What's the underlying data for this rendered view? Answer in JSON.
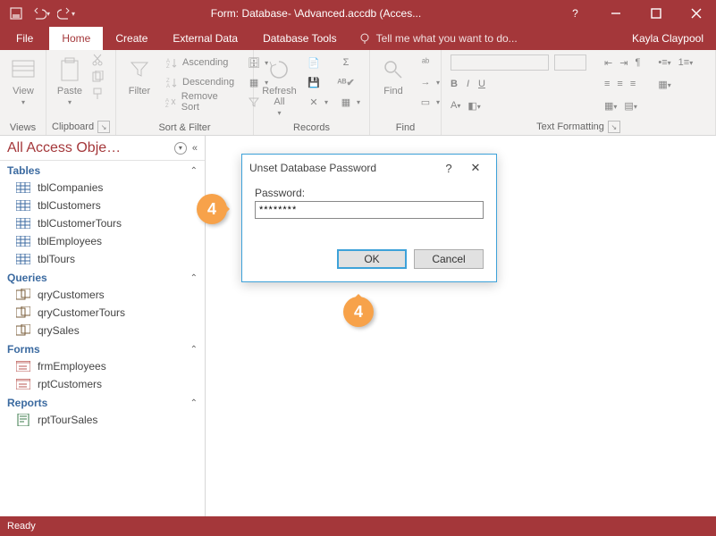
{
  "title": "Form: Database- \\Advanced.accdb (Acces...",
  "user": "Kayla Claypool",
  "tabs": {
    "file": "File",
    "home": "Home",
    "create": "Create",
    "external": "External Data",
    "tools": "Database Tools",
    "tellme": "Tell me what you want to do..."
  },
  "ribbon": {
    "views": {
      "label": "Views",
      "view": "View"
    },
    "clipboard": {
      "label": "Clipboard",
      "paste": "Paste"
    },
    "sortfilter": {
      "label": "Sort & Filter",
      "filter": "Filter",
      "asc": "Ascending",
      "desc": "Descending",
      "remove": "Remove Sort"
    },
    "records": {
      "label": "Records",
      "refresh": "Refresh\nAll"
    },
    "find": {
      "label": "Find",
      "find": "Find"
    },
    "textfmt": {
      "label": "Text Formatting"
    }
  },
  "nav": {
    "title": "All Access Obje…",
    "groups": [
      {
        "name": "Tables",
        "items": [
          "tblCompanies",
          "tblCustomers",
          "tblCustomerTours",
          "tblEmployees",
          "tblTours"
        ],
        "icon": "table"
      },
      {
        "name": "Queries",
        "items": [
          "qryCustomers",
          "qryCustomerTours",
          "qrySales"
        ],
        "icon": "query"
      },
      {
        "name": "Forms",
        "items": [
          "frmEmployees",
          "rptCustomers"
        ],
        "icon": "form"
      },
      {
        "name": "Reports",
        "items": [
          "rptTourSales"
        ],
        "icon": "report"
      }
    ]
  },
  "dialog": {
    "title": "Unset Database Password",
    "label": "Password:",
    "value": "********",
    "ok": "OK",
    "cancel": "Cancel"
  },
  "callout": "4",
  "status": "Ready"
}
